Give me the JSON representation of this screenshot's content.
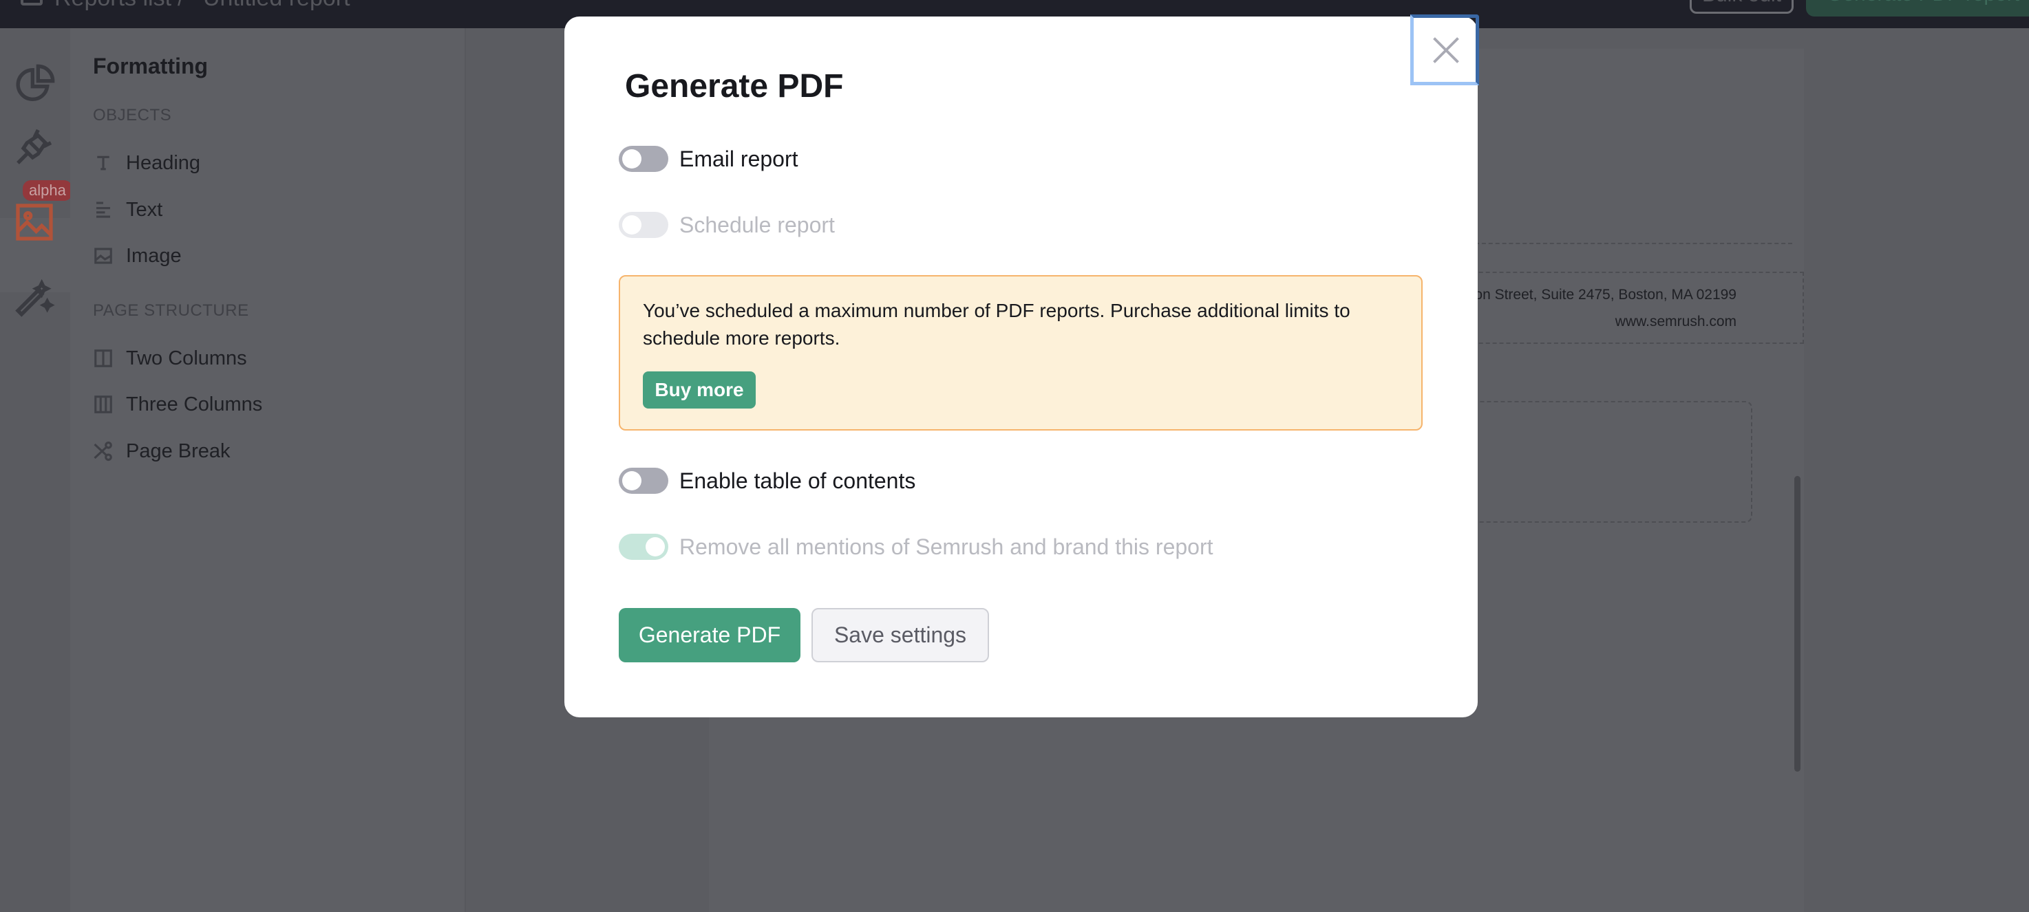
{
  "topbar": {
    "breadcrumb_root": "Reports list",
    "breadcrumb_separator": "/",
    "report_name": "Untitled report",
    "bulk_edit_label": "Bulk edit",
    "generate_report_label": "Generate PDF report"
  },
  "rail": {
    "alpha_badge": "alpha",
    "icons": [
      "pie-chart-icon",
      "plug-icon",
      "image-icon",
      "magic-wand-icon"
    ],
    "active_color": "#b0533a"
  },
  "sidebar": {
    "title": "Formatting",
    "objects_header": "OBJECTS",
    "objects": [
      {
        "label": "Heading",
        "icon": "heading-icon"
      },
      {
        "label": "Text",
        "icon": "text-icon"
      },
      {
        "label": "Image",
        "icon": "image-icon"
      }
    ],
    "structure_header": "PAGE STRUCTURE",
    "structure": [
      {
        "label": "Two Columns",
        "icon": "two-columns-icon"
      },
      {
        "label": "Three Columns",
        "icon": "three-columns-icon"
      },
      {
        "label": "Page Break",
        "icon": "scissors-icon"
      }
    ]
  },
  "document": {
    "address": "on Street, Suite 2475, Boston, MA 02199",
    "website": "www.semrush.com"
  },
  "modal": {
    "title": "Generate PDF",
    "email_report": {
      "label": "Email report",
      "on": false,
      "disabled": false
    },
    "schedule_report": {
      "label": "Schedule report",
      "on": false,
      "disabled": true
    },
    "warning": {
      "text": "You’ve scheduled a maximum number of PDF reports. Purchase additional limits to schedule more reports.",
      "button": "Buy more"
    },
    "table_of_contents": {
      "label": "Enable table of contents",
      "on": false,
      "disabled": false
    },
    "branding": {
      "label": "Remove all mentions of Semrush and brand this report",
      "on": true,
      "disabled": true
    },
    "generate_button": "Generate PDF",
    "save_button": "Save settings",
    "accent_color": "#46a07f"
  }
}
